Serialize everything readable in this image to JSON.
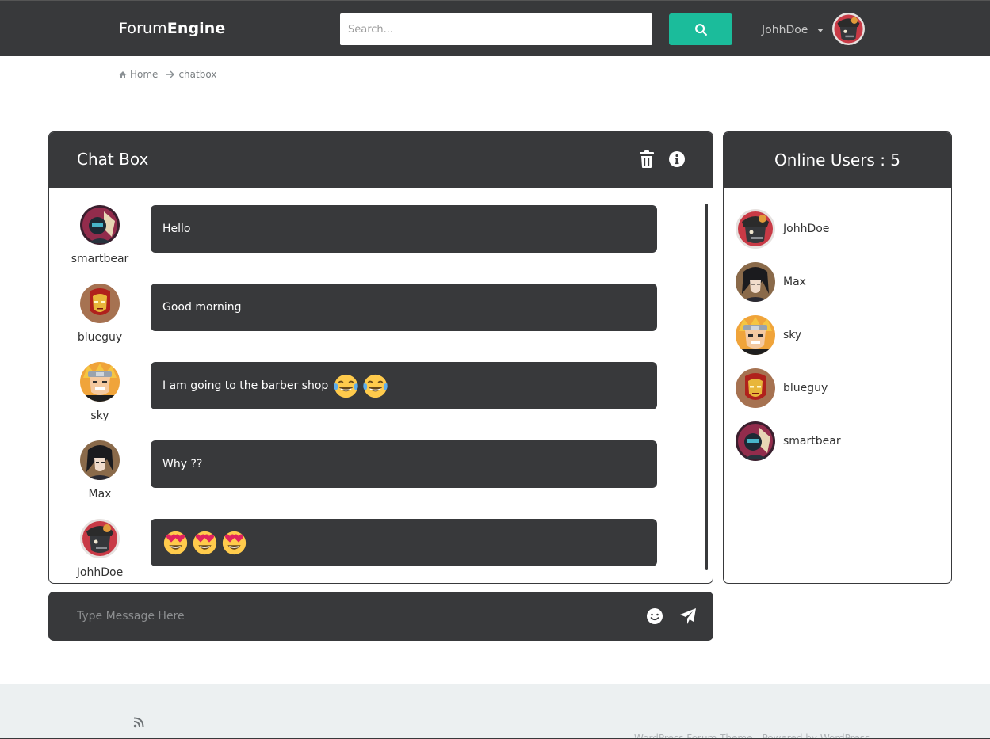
{
  "header": {
    "brand_light": "Forum",
    "brand_bold": "Engine",
    "search_placeholder": "Search...",
    "username": "JohhDoe"
  },
  "breadcrumb": {
    "home": "Home",
    "current": "chatbox"
  },
  "chat": {
    "title": "Chat Box",
    "messages": [
      {
        "user": "smartbear",
        "text": "Hello",
        "emojis": []
      },
      {
        "user": "blueguy",
        "text": "Good morning",
        "emojis": []
      },
      {
        "user": "sky",
        "text": "I am going to the barber shop",
        "emojis": [
          "face-with-tears-of-joy",
          "face-with-tears-of-joy"
        ]
      },
      {
        "user": "Max",
        "text": "Why ??",
        "emojis": []
      },
      {
        "user": "JohhDoe",
        "text": "",
        "emojis": [
          "heart-eyes",
          "heart-eyes",
          "heart-eyes"
        ]
      }
    ]
  },
  "composer": {
    "placeholder": "Type Message Here"
  },
  "online": {
    "title": "Online Users : 5",
    "users": [
      "JohhDoe",
      "Max",
      "sky",
      "blueguy",
      "smartbear"
    ]
  },
  "footer": {
    "credit": "WordPress Forum Theme - Powered by WordPress"
  },
  "colors": {
    "dark": "#38393b",
    "accent": "#1bbc9b",
    "footer_bg": "#ecf0f1"
  }
}
